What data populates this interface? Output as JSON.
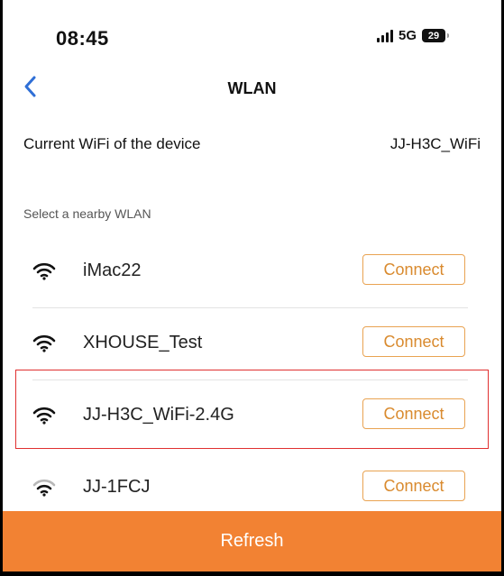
{
  "status_bar": {
    "time": "08:45",
    "network": "5G",
    "battery": "29"
  },
  "nav": {
    "title": "WLAN",
    "back_icon": "chevron-left-icon"
  },
  "current_wifi": {
    "label": "Current WiFi of the device",
    "value": "JJ-H3C_WiFi"
  },
  "section_label": "Select a nearby WLAN",
  "wlan_list": [
    {
      "name": "iMac22",
      "button_label": "Connect",
      "icon": "wifi-icon"
    },
    {
      "name": "XHOUSE_Test",
      "button_label": "Connect",
      "icon": "wifi-icon"
    },
    {
      "name": "JJ-H3C_WiFi-2.4G",
      "button_label": "Connect",
      "icon": "wifi-icon",
      "highlighted": true
    },
    {
      "name": "JJ-1FCJ",
      "button_label": "Connect",
      "icon": "wifi-icon-weak"
    }
  ],
  "refresh_label": "Refresh",
  "colors": {
    "accent": "#f28233",
    "connect_border": "#e9a352",
    "connect_text": "#d98a2e",
    "back_icon": "#2f6fd6",
    "highlight": "#e03030"
  }
}
